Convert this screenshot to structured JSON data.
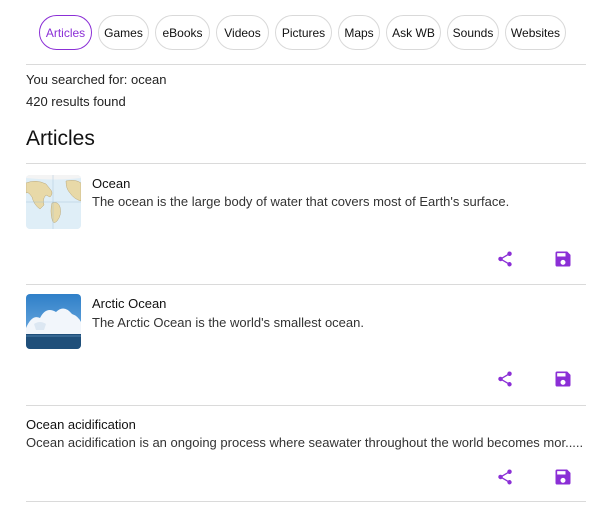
{
  "tabs": [
    {
      "label": "Articles",
      "active": true
    },
    {
      "label": "Games",
      "active": false
    },
    {
      "label": "eBooks",
      "active": false
    },
    {
      "label": "Videos",
      "active": false
    },
    {
      "label": "Pictures",
      "active": false
    },
    {
      "label": "Maps",
      "active": false
    },
    {
      "label": "Ask WB",
      "active": false
    },
    {
      "label": "Sounds",
      "active": false
    },
    {
      "label": "Websites",
      "active": false
    }
  ],
  "search": {
    "query_text": "You searched for: ocean",
    "count_text": "420 results found"
  },
  "section": {
    "title": "Articles"
  },
  "results": [
    {
      "title": "Ocean",
      "description": "The ocean is the large body of water that covers most of Earth's surface.",
      "thumbnail": "world-map-thumbnail"
    },
    {
      "title": "Arctic Ocean",
      "description": "The Arctic Ocean is the world's smallest ocean.",
      "thumbnail": "arctic-ice-thumbnail"
    },
    {
      "title": "Ocean acidification",
      "description": "Ocean acidification is an ongoing process where seawater throughout the world becomes mor.....",
      "thumbnail": null
    }
  ],
  "icons": {
    "share": "share-icon",
    "save": "save-icon"
  },
  "colors": {
    "accent": "#8b2fd6"
  }
}
